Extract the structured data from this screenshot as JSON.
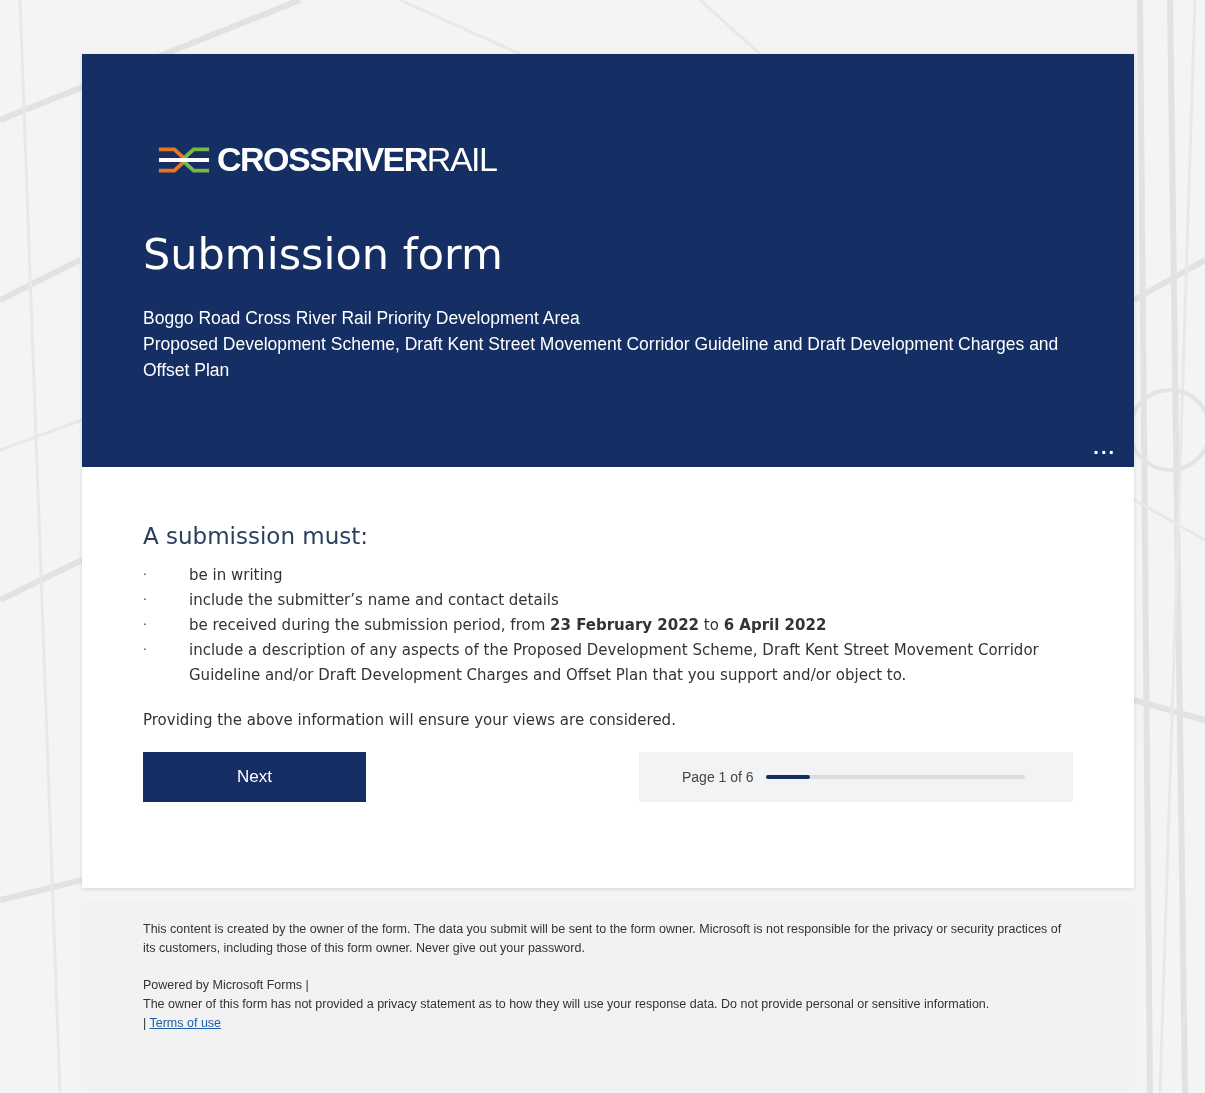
{
  "logo": {
    "bold": "CROSSRIVER",
    "light": "RAIL"
  },
  "header": {
    "title": "Submission form",
    "description": [
      "Boggo Road Cross River Rail Priority Development Area",
      "Proposed Development Scheme, Draft Kent Street Movement Corridor Guideline and Draft Development Charges and Offset Plan"
    ],
    "more": "..."
  },
  "section": {
    "heading": "A submission must:",
    "items": [
      {
        "bullet": "·",
        "text": "be in writing"
      },
      {
        "bullet": "·",
        "text": "include the submitter’s name and contact details"
      },
      {
        "bullet": "·",
        "text": "be received during the submission period, from **23 February 2022** to **6 April 2022**"
      },
      {
        "bullet": "·",
        "text": "include a description of any aspects of the Proposed Development Scheme, Draft Kent Street Movement Corridor Guideline and/or Draft Development Charges and Offset Plan that you support and/or object to."
      }
    ],
    "note": "Providing the above information will ensure your views are considered."
  },
  "next_button": "Next",
  "progress": {
    "label": "Page 1 of 6",
    "level": 0.17
  },
  "footer": {
    "disclaimer": "This content is created by the owner of the form. The data you submit will be sent to the form owner. Microsoft is not responsible for the privacy or security practices of its customers, including those of this form owner. Never give out your password.",
    "powered_by": "Powered by Microsoft Forms |",
    "privacy": "The owner of this form has not provided a privacy statement as to how they will use your response data. Do not provide personal or sensitive information.",
    "separator": "|",
    "terms_link": "Terms of use"
  }
}
